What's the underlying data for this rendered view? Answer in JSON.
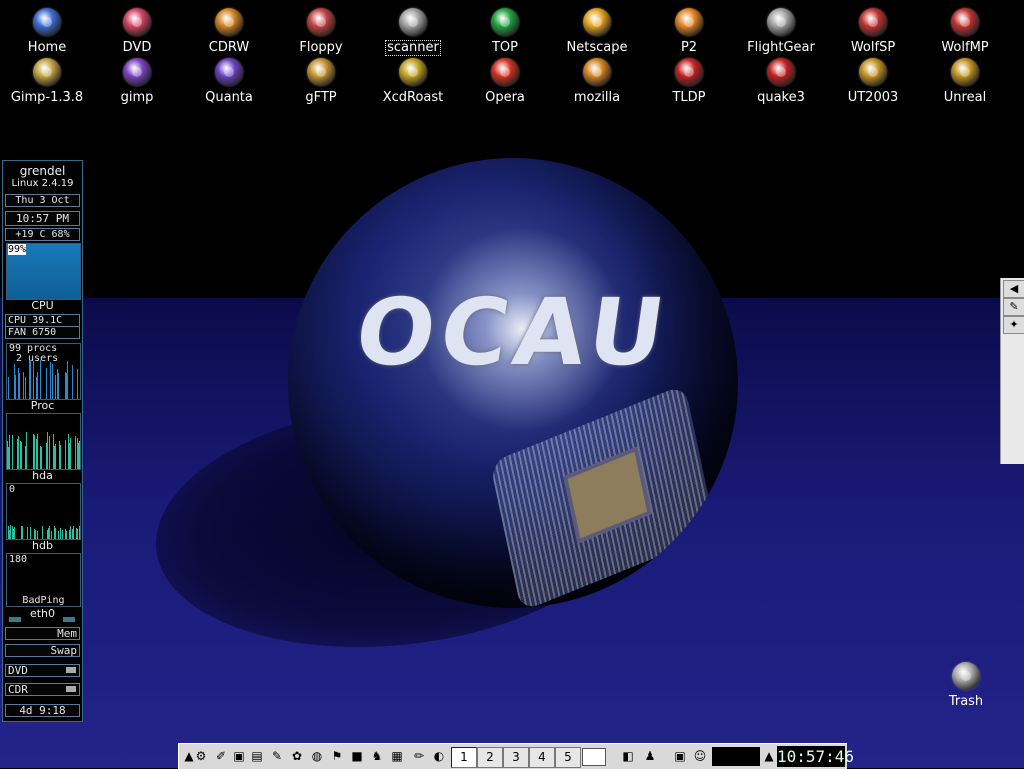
{
  "desktop": {
    "icons": [
      {
        "label": "Home",
        "color": "#3a6ad0",
        "selected": false
      },
      {
        "label": "DVD",
        "color": "#d04060",
        "selected": false
      },
      {
        "label": "CDRW",
        "color": "#d08020",
        "selected": false
      },
      {
        "label": "Floppy",
        "color": "#c04040",
        "selected": false
      },
      {
        "label": "scanner",
        "color": "#a0a0a0",
        "selected": true
      },
      {
        "label": "TOP",
        "color": "#20a040",
        "selected": false
      },
      {
        "label": "Netscape",
        "color": "#e0a020",
        "selected": false
      },
      {
        "label": "P2",
        "color": "#e08020",
        "selected": false
      },
      {
        "label": "FlightGear",
        "color": "#a0a0a0",
        "selected": false
      },
      {
        "label": "WolfSP",
        "color": "#c03030",
        "selected": false
      },
      {
        "label": "WolfMP",
        "color": "#c03030",
        "selected": false
      },
      {
        "label": "Gimp-1.3.8",
        "color": "#c0a040",
        "selected": false
      },
      {
        "label": "gimp",
        "color": "#7a40c0",
        "selected": false
      },
      {
        "label": "Quanta",
        "color": "#6a40c0",
        "selected": false
      },
      {
        "label": "gFTP",
        "color": "#c09030",
        "selected": false
      },
      {
        "label": "XcdRoast",
        "color": "#c0a020",
        "selected": false
      },
      {
        "label": "Opera",
        "color": "#d03020",
        "selected": false
      },
      {
        "label": "mozilla",
        "color": "#d08020",
        "selected": false
      },
      {
        "label": "TLDP",
        "color": "#c02020",
        "selected": false
      },
      {
        "label": "quake3",
        "color": "#c02020",
        "selected": false
      },
      {
        "label": "UT2003",
        "color": "#c09020",
        "selected": false
      },
      {
        "label": "Unreal",
        "color": "#c09020",
        "selected": false
      }
    ],
    "trash": {
      "label": "Trash"
    },
    "wallpaper_text": "OCAU"
  },
  "gkrellm": {
    "hostname": "grendel",
    "kernel": "Linux 2.4.19",
    "date": "Thu  3 Oct",
    "time": "10:57 PM",
    "weather": "+19 C 68%",
    "cpu_percent": "99%",
    "cpu_label": "CPU",
    "cpu_temp": "CPU  39.1C",
    "fan": "FAN  6750",
    "procs": "99 procs",
    "users": "2 users",
    "proc_label": "Proc",
    "hda_label": "hda",
    "hdb_value": "0",
    "hdb_label": "hdb",
    "ping_value": "180",
    "ping_label": "BadPing",
    "eth_label": "eth0",
    "mem_label": "Mem",
    "swap_label": "Swap",
    "dvd_label": "DVD",
    "cdr_label": "CDR",
    "uptime": "4d  9:18"
  },
  "taskbar": {
    "workspaces": [
      "1",
      "2",
      "3",
      "4",
      "5"
    ],
    "active_workspace": "1",
    "clock": "10:57:46"
  }
}
